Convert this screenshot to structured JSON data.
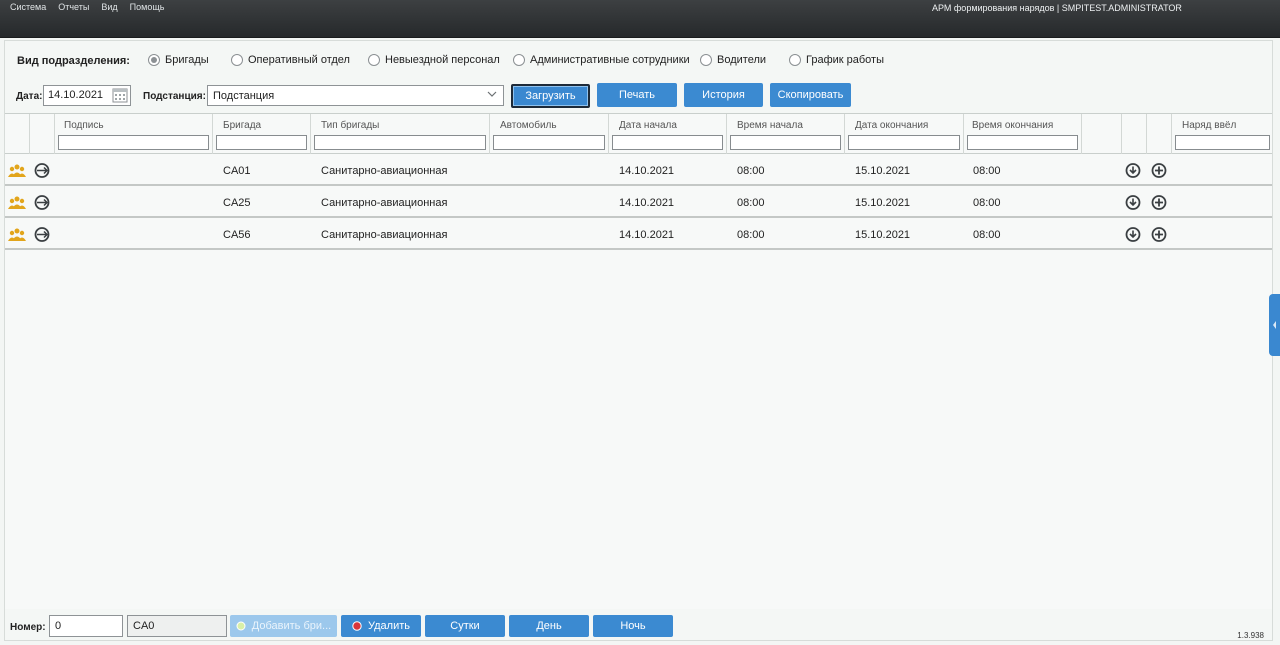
{
  "menu": [
    "Система",
    "Отчеты",
    "Вид",
    "Помощь"
  ],
  "app_title": "АРМ формирования нарядов | SMPITEST.ADMINISTRATOR",
  "unit_kind": {
    "label": "Вид подразделения:",
    "options": [
      "Бригады",
      "Оперативный отдел",
      "Невыездной персонал",
      "Административные сотрудники",
      "Водители",
      "График работы"
    ],
    "selected": "Бригады"
  },
  "toolbar": {
    "date_label": "Дата:",
    "date_value": "14.10.2021",
    "station_label": "Подстанция:",
    "station_value": "Подстанция",
    "load": "Загрузить",
    "print": "Печать",
    "history": "История",
    "copy": "Скопировать"
  },
  "grid": {
    "columns": [
      "Подпись",
      "Бригада",
      "Тип бригады",
      "Автомобиль",
      "Дата начала",
      "Время начала",
      "Дата окончания",
      "Время окончания",
      "Наряд ввёл"
    ],
    "rows": [
      {
        "team": "CA01",
        "type": "Санитарно-авиационная",
        "car": "",
        "start_date": "14.10.2021",
        "start_time": "08:00",
        "end_date": "15.10.2021",
        "end_time": "08:00",
        "entered_by": ""
      },
      {
        "team": "CA25",
        "type": "Санитарно-авиационная",
        "car": "",
        "start_date": "14.10.2021",
        "start_time": "08:00",
        "end_date": "15.10.2021",
        "end_time": "08:00",
        "entered_by": ""
      },
      {
        "team": "CA56",
        "type": "Санитарно-авиационная",
        "car": "",
        "start_date": "14.10.2021",
        "start_time": "08:00",
        "end_date": "15.10.2021",
        "end_time": "08:00",
        "entered_by": ""
      }
    ]
  },
  "footer": {
    "number_label": "Номер:",
    "number_value": "0",
    "code_value": "CA0",
    "add_team": "Добавить бри...",
    "delete": "Удалить",
    "day_full": "Сутки",
    "day": "День",
    "night": "Ночь",
    "version": "1.3.938"
  },
  "colors": {
    "accent": "#3b8ad1",
    "topbar": "#2f3234",
    "team_icon": "#e2a51b"
  },
  "icons": [
    "team-members-icon",
    "refresh-crew-icon",
    "calendar-icon",
    "chevron-down-icon",
    "undo-icon",
    "add-circle-icon",
    "add-icon",
    "delete-icon",
    "collapse-arrow-icon"
  ]
}
